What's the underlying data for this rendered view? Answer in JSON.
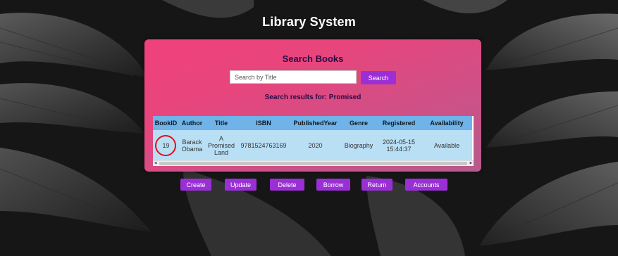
{
  "app": {
    "title": "Library System"
  },
  "search": {
    "heading": "Search Books",
    "placeholder": "Search by Title",
    "button_label": "Search",
    "results_text": "Search results for: Promised"
  },
  "table": {
    "headers": [
      "BookID",
      "Author",
      "Title",
      "ISBN",
      "PublishedYear",
      "Genre",
      "Registered",
      "Availability"
    ],
    "rows": [
      {
        "book_id": "19",
        "author": "Barack Obama",
        "title": "A Promised Land",
        "isbn": "9781524763169",
        "published_year": "2020",
        "genre": "Biography",
        "registered": "2024-05-15 15:44:37",
        "availability": "Available"
      }
    ]
  },
  "actions": {
    "create": "Create",
    "update": "Update",
    "delete": "Delete",
    "borrow": "Borrow",
    "return": "Return",
    "accounts": "Accounts"
  },
  "colors": {
    "panel_gradient_start": "#f0417c",
    "panel_gradient_end": "#b85a8c",
    "button_purple": "#9b2fd6",
    "table_header": "#6fb3e8",
    "table_row": "#b9dff5",
    "highlight_circle": "#e0101a"
  }
}
